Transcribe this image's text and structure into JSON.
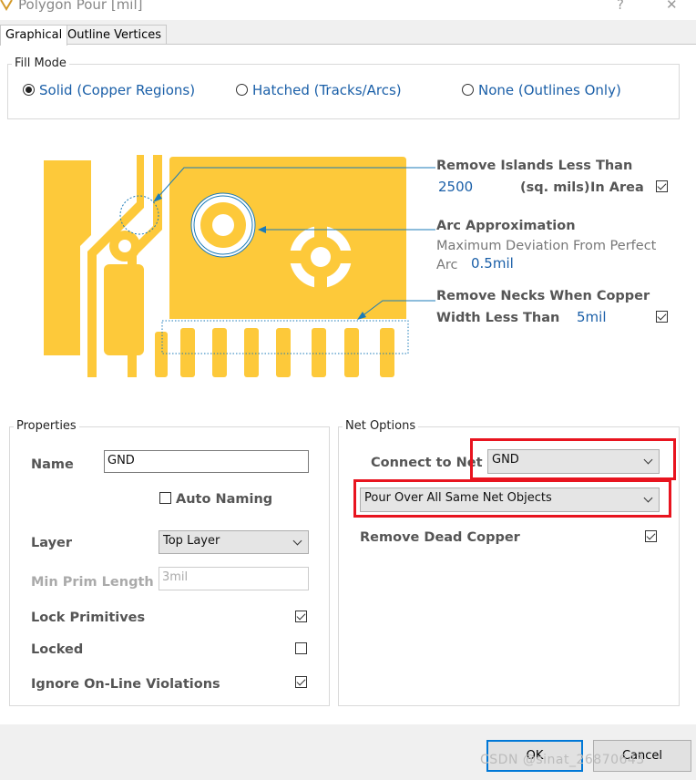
{
  "window": {
    "title": "Polygon Pour [mil]",
    "help_glyph": "?",
    "close_glyph": "✕"
  },
  "tabs": [
    {
      "label": "Graphical",
      "active": true
    },
    {
      "label": "Outline Vertices",
      "active": false
    }
  ],
  "fill_mode": {
    "legend": "Fill Mode",
    "options": [
      {
        "label": "Solid (Copper Regions)",
        "checked": true
      },
      {
        "label": "Hatched (Tracks/Arcs)",
        "checked": false
      },
      {
        "label": "None (Outlines Only)",
        "checked": false
      }
    ]
  },
  "preview": {
    "copper_color": "#fdc93a",
    "remove_islands": {
      "title": "Remove Islands Less Than",
      "value": "2500",
      "unit": "(sq. mils)",
      "suffix": "In Area",
      "checked": true
    },
    "arc_approx": {
      "title": "Arc Approximation",
      "desc_line1": "Maximum Deviation From Perfect",
      "desc_line2": "Arc",
      "value": "0.5mil"
    },
    "remove_necks": {
      "title_line1": "Remove Necks When Copper",
      "title_line2": "Width Less Than",
      "value": "5mil",
      "checked": true
    }
  },
  "properties": {
    "legend": "Properties",
    "name_label": "Name",
    "name_value": "GND",
    "auto_naming_label": "Auto Naming",
    "auto_naming_checked": false,
    "layer_label": "Layer",
    "layer_value": "Top Layer",
    "min_prim_label": "Min Prim Length",
    "min_prim_value": "3mil",
    "lock_primitives_label": "Lock Primitives",
    "lock_primitives_checked": true,
    "locked_label": "Locked",
    "locked_checked": false,
    "ignore_violations_label": "Ignore On-Line Violations",
    "ignore_violations_checked": true
  },
  "net_options": {
    "legend": "Net Options",
    "connect_label": "Connect to Net",
    "connect_value": "GND",
    "pour_value": "Pour Over All Same Net Objects",
    "remove_dead_label": "Remove Dead Copper",
    "remove_dead_checked": true
  },
  "buttons": {
    "ok": "OK",
    "cancel": "Cancel"
  },
  "watermark": "CSDN @sinat_26870643",
  "colors": {
    "highlight": "#e8141f",
    "link_blue": "#1a5fa8"
  }
}
